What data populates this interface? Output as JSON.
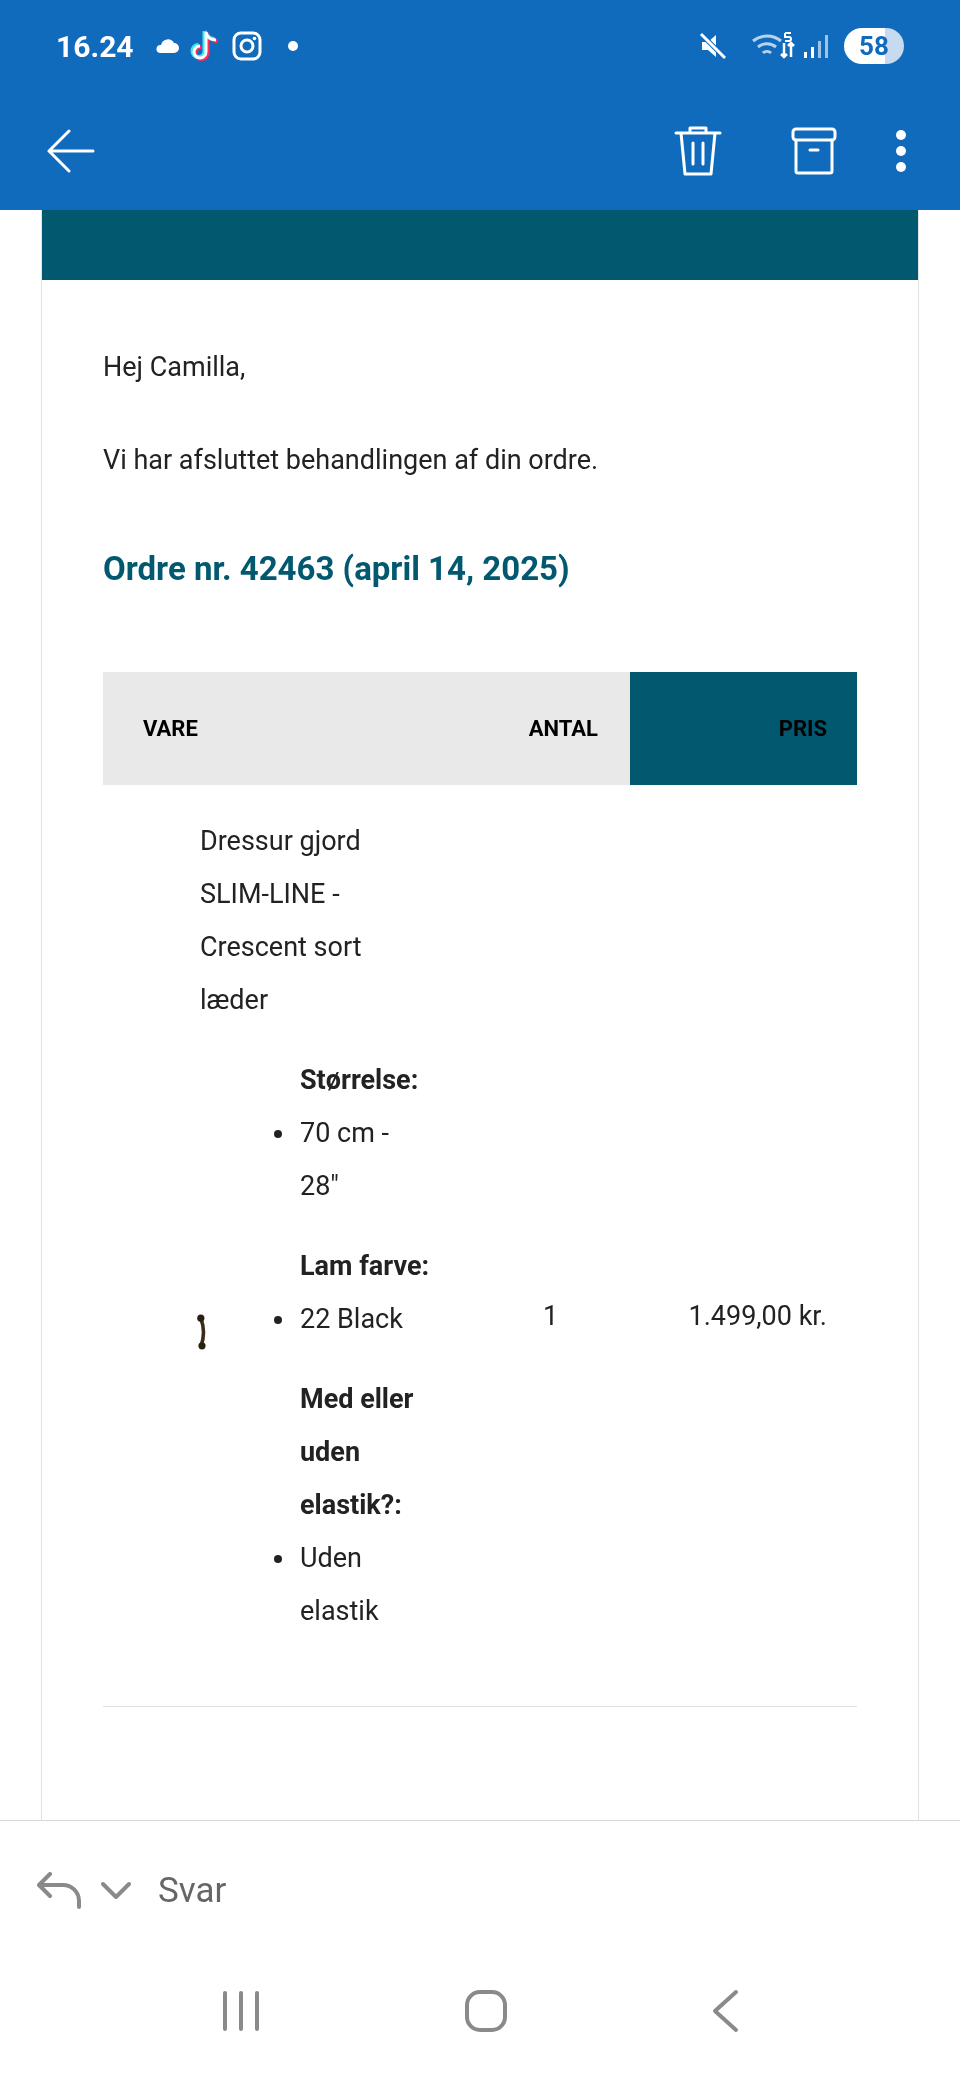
{
  "status_bar": {
    "time": "16.24",
    "battery": "58"
  },
  "email": {
    "greeting": "Hej Camilla,",
    "message": "Vi har afsluttet behandlingen af din ordre.",
    "order_heading": "Ordre nr. 42463 (april 14, 2025)"
  },
  "table": {
    "columns": [
      "VARE",
      "ANTAL",
      "PRIS"
    ],
    "rows": [
      {
        "product": "Dressur gjord SLIM-LINE - Crescent sort læder",
        "quantity": "1",
        "price": "1.499,00 kr.",
        "attributes": [
          {
            "label": "Størrelse:",
            "value": "70 cm - 28\""
          },
          {
            "label": "Lam farve:",
            "value": "22 Black"
          },
          {
            "label": "Med eller uden elastik?:",
            "value": "Uden elastik"
          }
        ]
      }
    ]
  },
  "reply_bar": {
    "label": "Svar"
  }
}
